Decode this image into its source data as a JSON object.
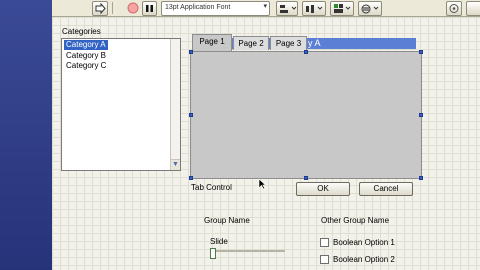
{
  "toolbar": {
    "font_select": "13pt Application Font"
  },
  "categories": {
    "label": "Categories",
    "items": [
      "Category A",
      "Category B",
      "Category C"
    ],
    "selected_index": 0
  },
  "tab_control": {
    "label": "Tab Control",
    "tabs": [
      "Page 1",
      "Page 2",
      "Page 3"
    ],
    "active_index": 0,
    "header_text": "y A"
  },
  "buttons": {
    "ok": "OK",
    "cancel": "Cancel"
  },
  "group_name": {
    "label": "Group Name",
    "slide_label": "Slide"
  },
  "other_group": {
    "label": "Other Group Name",
    "option1": "Boolean Option 1",
    "option2": "Boolean Option 2"
  }
}
